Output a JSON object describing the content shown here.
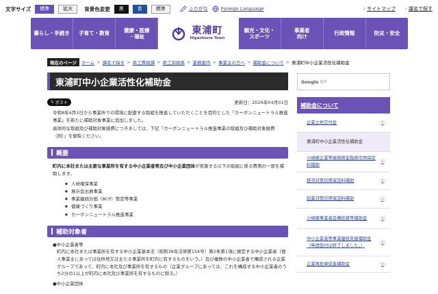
{
  "topbar": {
    "text_size_label": "文字サイズ",
    "size_standard": "標準",
    "size_large": "拡大",
    "bg_label": "背景色変更",
    "bg_black": "黒",
    "bg_blue": "青",
    "bg_standard": "標準",
    "furigana": "ふりがな",
    "foreign_language": "Foreign Language",
    "sitemap": "サイトマップ",
    "search_by_topic": "課名で探す"
  },
  "nav": {
    "items_left": [
      "暮らし・手続き",
      "子育て・教育",
      "健康・医療\n・福祉"
    ],
    "logo_jp": "東浦町",
    "logo_en": "Higashiura Town",
    "items_right": [
      "観光・文化・\nスポーツ",
      "事業者\n向け",
      "行政情報",
      "防災・安全"
    ]
  },
  "breadcrumb": {
    "current_label": "現在のページ",
    "links": [
      "ホーム",
      "課名で探す",
      "商工費政課",
      "商工労政係",
      "業務案内",
      "事業主の方へ",
      "補助金について"
    ],
    "current": "東浦町中小企業活性化補助金"
  },
  "main": {
    "title": "東浦町中小企業活性化補助金",
    "post_label": "ポスト",
    "updated": "更新日：2026年04月01日",
    "intro_1": "令和8年4月1日から事業所での環境に配慮する取組を推進していただくことを目的とした「カーボンニュートラル推進事業」を新たに補助対象事業に追加しました。",
    "intro_2": "具体的な取組及び補助対象経費につきましては、下記「カーボンニュートラル推進事業の取組及び補助対象経費（例）」を御覧ください。",
    "overview_heading": "概要",
    "overview_strong": "町内に本社または主要な事業所を有する中小企業者等及び中小企業団体",
    "overview_text": "が実施する以下の取組に係る費用の一部を補助します。",
    "bullets": [
      "人材確保事業",
      "展示会出展事業",
      "事業継続計画（BCP）策定等事業",
      "健康づくり事業",
      "カーボンニュートラル推進事業"
    ],
    "target_heading": "補助対象者",
    "target_1": "●中小企業者等",
    "target_2": "町内に本社または事業所を有する中小企業基本法（昭和38年法律第154号）第2条第1項に規定する中小企業者（個人事業主にあっては住所地又は主たる事業所を町内に有するものをいう。）及び複数の中小企業者で構成される企業グループであって、町内に本社及び事業所を有するもの（企業グループにあっては、これを構成する中小企業者のうち2分の1以上が町内に本社及び事業所を有するものに限る。）",
    "target_3": "●中小企業団体"
  },
  "sidebar": {
    "search_brand": "Google",
    "search_placeholder": "提供",
    "heading": "補助金について",
    "items": [
      "企業立地交付金",
      "東浦町中小企業活性化補助金",
      "小規模企業等振興資金融資信用保証料補助",
      "経済対策信用保証料補助",
      "創業対策信用保証料補助",
      "小規模事業者設備投資等補助金",
      "中小企業者等事業継続支援補助金（申請受付は終了しました。）",
      "企業再投資促進補助金"
    ]
  },
  "colors": {
    "brand_purple": "#6b52b7",
    "link_blue": "#2e48a8",
    "title_dark": "#2b2b2b"
  }
}
